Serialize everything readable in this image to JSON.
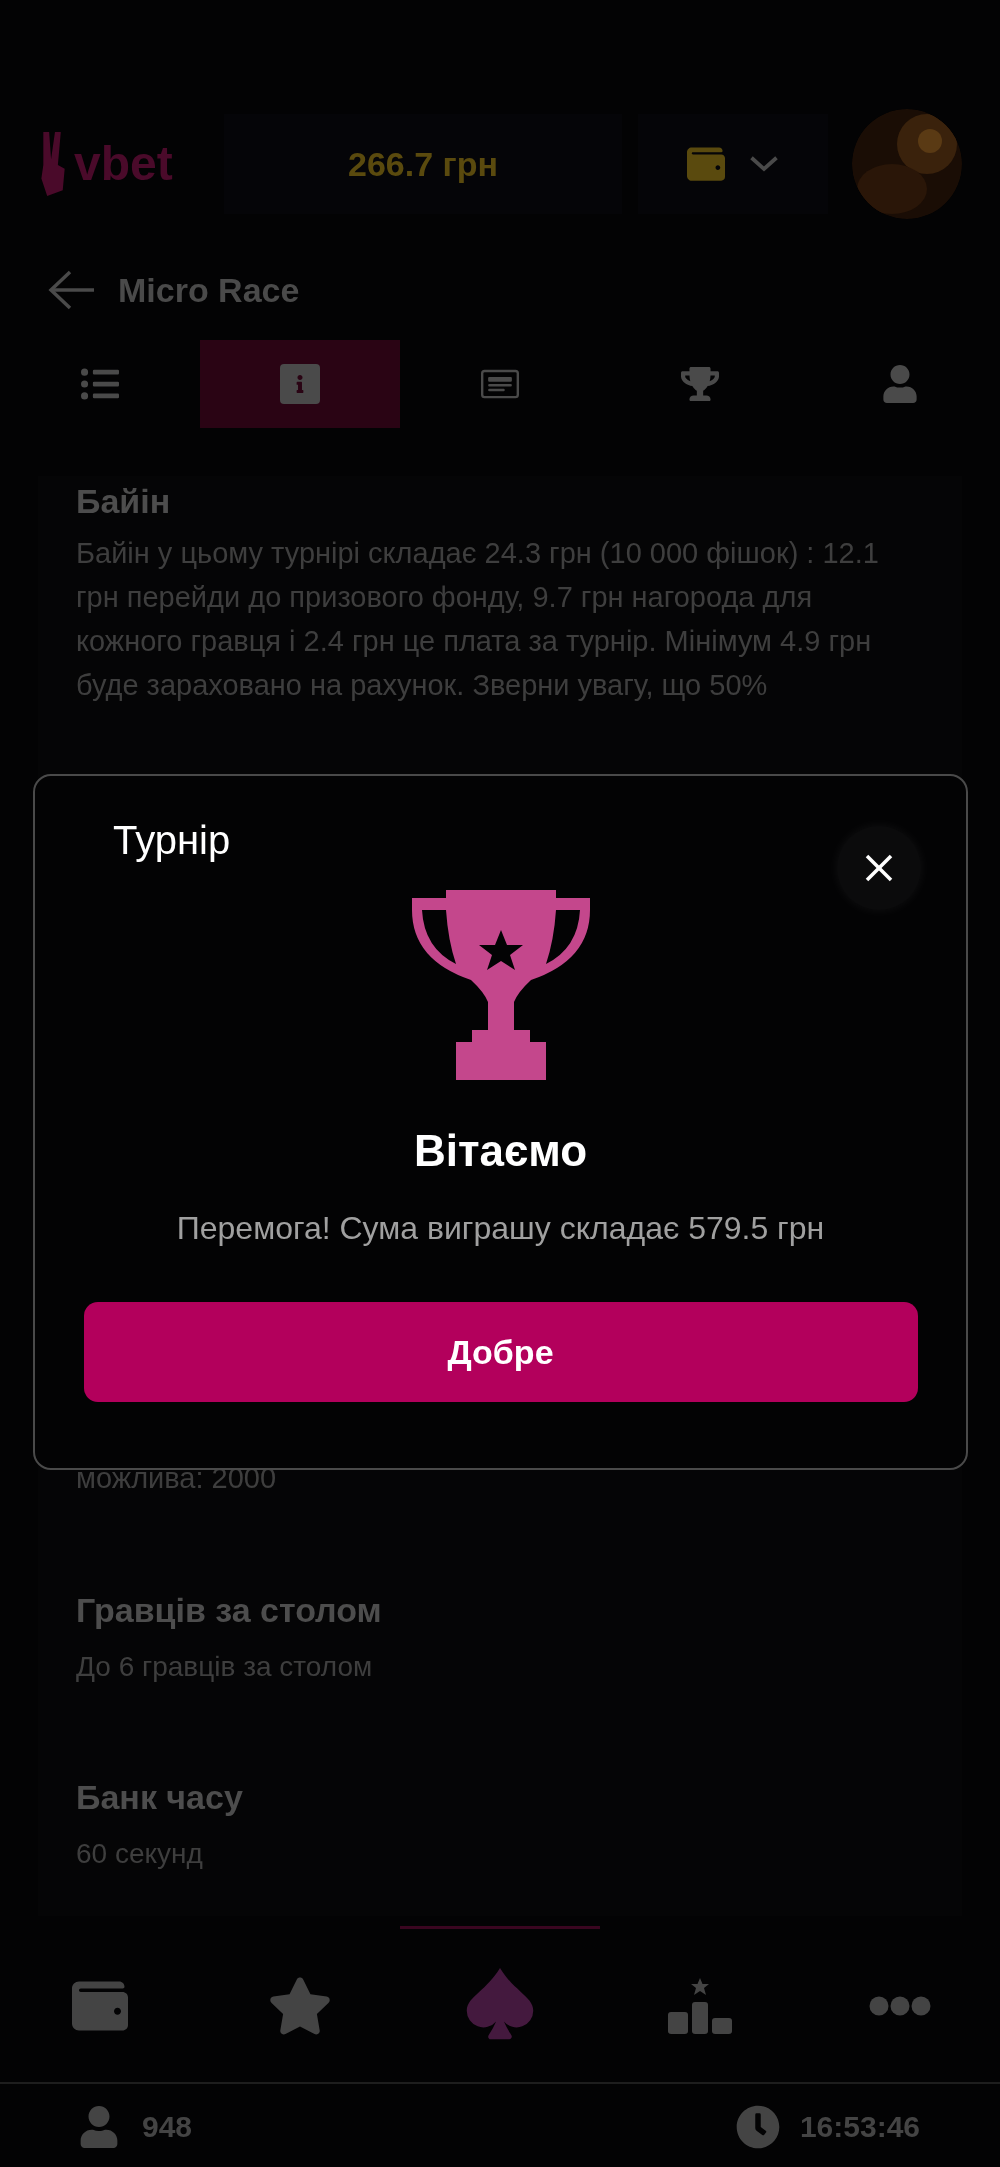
{
  "header": {
    "logo": "vbet",
    "balance": "266.7 грн"
  },
  "page_title": "Micro Race",
  "tabs": [
    {
      "kind": "list",
      "selected": false
    },
    {
      "kind": "info",
      "selected": true
    },
    {
      "kind": "card",
      "selected": false
    },
    {
      "kind": "trophy",
      "selected": false
    },
    {
      "kind": "user",
      "selected": false
    }
  ],
  "buyin": {
    "title": "Байін",
    "text": "Байін у цьому турнірі складає 24.3 грн (10 000 фішок) : 12.1 грн перейди до призового фонду, 9.7 грн нагорода для кожного гравця і 2.4 грн це плата за турнір. Мінімум 4.9 грн буде зараховано на рахунок. Зверни увагу, що 50%"
  },
  "continued_text": "можлива: 2000",
  "sections": [
    {
      "title": "Гравців за столом",
      "text": "До 6 гравців за столом"
    },
    {
      "title": "Банк часу",
      "text": "60 секунд"
    }
  ],
  "dialog": {
    "title": "Турнір",
    "heading": "Вітаємо",
    "message": "Перемога! Сума виграшу складає 579.5 грн",
    "button": "Добре"
  },
  "bottom_nav": [
    {
      "kind": "wallet",
      "selected": false
    },
    {
      "kind": "star",
      "selected": false
    },
    {
      "kind": "spade",
      "selected": true
    },
    {
      "kind": "podium",
      "selected": false
    },
    {
      "kind": "more",
      "selected": false
    }
  ],
  "status_bar": {
    "players": "948",
    "time": "16:53:46"
  }
}
